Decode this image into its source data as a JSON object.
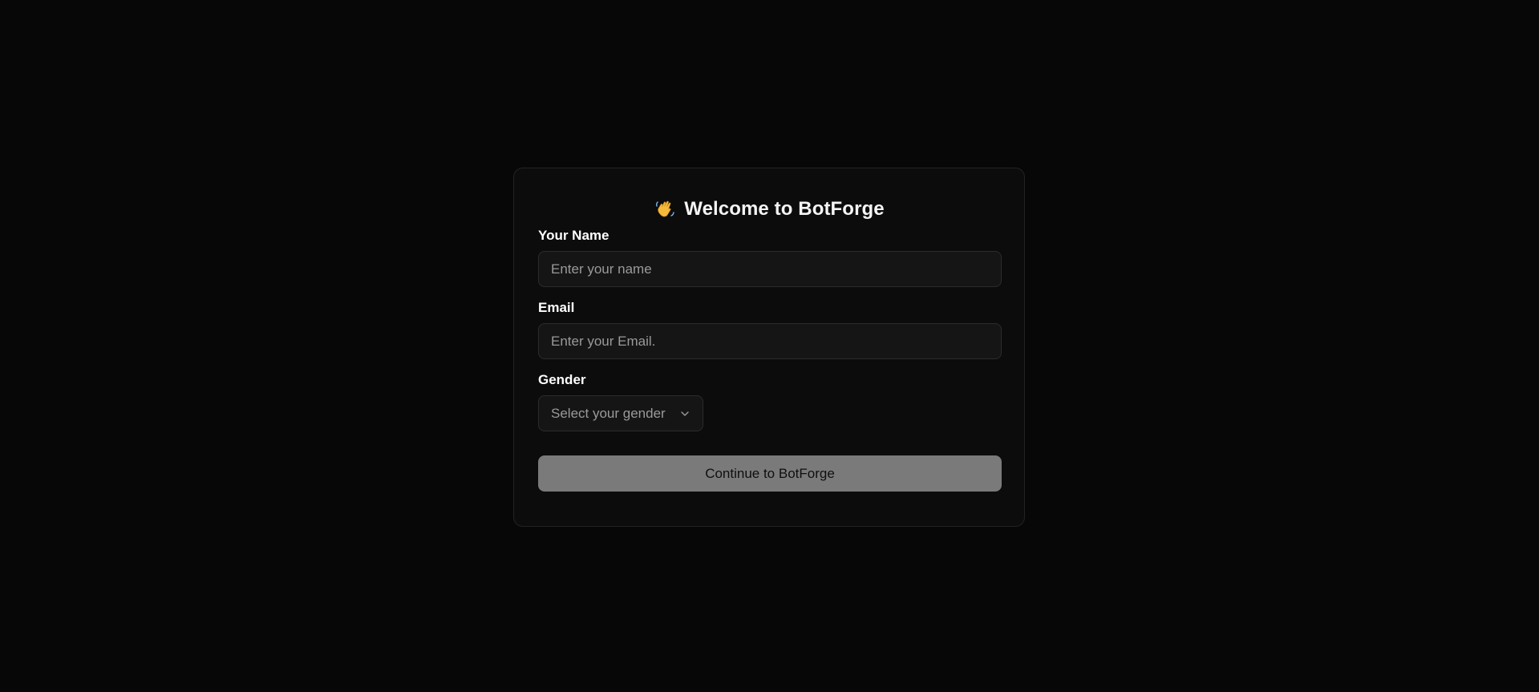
{
  "form": {
    "title": "Welcome to BotForge",
    "title_icon": "waving-hand-icon",
    "name": {
      "label": "Your Name",
      "value": "",
      "placeholder": "Enter your name"
    },
    "email": {
      "label": "Email",
      "value": "",
      "placeholder": "Enter your Email."
    },
    "gender": {
      "label": "Gender",
      "selected": "Select your gender",
      "icon": "chevron-down-icon"
    },
    "submit_label": "Continue to BotForge"
  },
  "colors": {
    "background": "#070707",
    "card": "#0c0c0c",
    "input_bg": "#151515",
    "button_bg": "#7a7a7a",
    "wave_yellow": "#f6b93b"
  }
}
